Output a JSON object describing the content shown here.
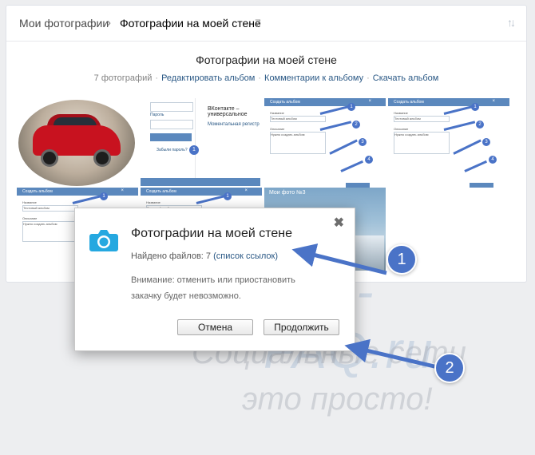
{
  "breadcrumb": {
    "root": "Мои фотографии",
    "separator": "›",
    "current": "Фотографии на моей стене",
    "count": "7"
  },
  "album": {
    "title": "Фотографии на моей стене",
    "photo_count": "7 фотографий",
    "links": [
      "Редактировать альбом",
      "Комментарии к альбому",
      "Скачать альбом"
    ]
  },
  "thumbnails": {
    "login": {
      "password_label": "Пароль",
      "forgot": "Забыли пароль?",
      "number": "1",
      "right_title": "ВКонтакте – универсальное",
      "right_link": "Моментальная регистр"
    },
    "album_form": {
      "title": "Создать альбом",
      "close": "×",
      "name_label": "Название",
      "name_value": "Тестовый альбом",
      "desc_label": "Описание",
      "desc_value": "Нужно создать альбом",
      "numbers": [
        "1",
        "2",
        "3",
        "4"
      ]
    },
    "sky": {
      "caption": "Мои фото №3"
    }
  },
  "watermark": {
    "line1": "Soc-FAQ.ru",
    "line2": "Социальные сети",
    "line3": "это просто!"
  },
  "dialog": {
    "title": "Фотографии на моей стене",
    "found_label": "Найдено файлов: 7",
    "found_link": "(список ссылок)",
    "warning": "Внимание: отменить или приостановить закачку будет невозможно.",
    "cancel_label": "Отмена",
    "continue_label": "Продолжить",
    "close_symbol": "✖"
  },
  "callouts": [
    "1",
    "2"
  ],
  "colors": {
    "accent": "#4a73c7",
    "link": "#2a5885",
    "camera": "#25a8e0",
    "background": "#edeef0"
  }
}
